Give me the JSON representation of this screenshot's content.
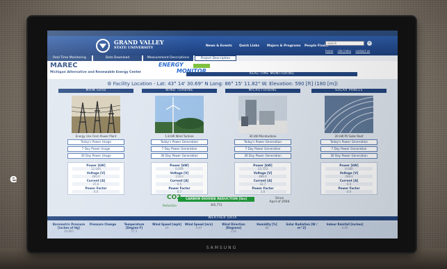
{
  "monitor": {
    "brand": "SAMSUNG"
  },
  "header": {
    "logo_name": "GRAND VALLEY",
    "logo_sub": "STATE UNIVERSITY",
    "nav": [
      "News & Events",
      "Quick Links",
      "Majors & Programs",
      "People Finder"
    ],
    "search_placeholder": "search",
    "search_go": "»",
    "sublinks": [
      "home",
      "site index",
      "contact us"
    ]
  },
  "tabs": [
    "Real Time Monitoring",
    "Data Download",
    "Measurement Descriptions",
    "Project Description"
  ],
  "brand": {
    "title": "MAREC",
    "subtitle": "Michigan Alternative and Renewable Energy Center",
    "energy": "ENERGY",
    "monitor": "MONITOR"
  },
  "rtm_label": "REAL-TIME MONITORING",
  "facility_line": "Facility Location - Lat: 43° 14' 30.69\" N   Long: 86° 15' 11.82\" W.   Elevation: 590 [ft] (180 [m])",
  "columns": [
    {
      "head": "MAIN GRID",
      "caption": "Energy Use From Power Plant",
      "buttons": [
        "Today's Power Usage",
        "7 Day Power Usage",
        "30 Day Power Usage"
      ],
      "readings": [
        {
          "label": "Power [kW]",
          "value": "12.040"
        },
        {
          "label": "Voltage [V]",
          "value": "490.0"
        },
        {
          "label": "Current [A]",
          "value": "25.6"
        },
        {
          "label": "Power Factor",
          "value": "0.0"
        }
      ]
    },
    {
      "head": "WIND TURBINE",
      "caption": "1.8 kW Wind Turbine",
      "buttons": [
        "Today's Power Generation",
        "7 Day Power Generation",
        "30 Day Power Generation"
      ],
      "readings": [
        {
          "label": "Power [kW]",
          "value": "0.059"
        },
        {
          "label": "Voltage [V]",
          "value": "119.0"
        },
        {
          "label": "Current [A]",
          "value": "0.5"
        },
        {
          "label": "Power Factor",
          "value": "0.7"
        }
      ]
    },
    {
      "head": "MICROTURBINE",
      "caption": "30 kW Microturbine",
      "buttons": [
        "Today's Power Generation",
        "7 Day Power Generation",
        "30 Day Power Generation"
      ],
      "readings": [
        {
          "label": "Power [kW]",
          "value": "23.723"
        },
        {
          "label": "Voltage [V]",
          "value": "489.0"
        },
        {
          "label": "Current [A]",
          "value": "32.7"
        },
        {
          "label": "Power Factor",
          "value": "1.0"
        }
      ]
    },
    {
      "head": "SOLAR PANELS",
      "caption": "20 kW PV Solar Roof",
      "buttons": [
        "Today's Power Generation",
        "7 Day Power Generation",
        "30 Day Power Generation"
      ],
      "readings": [
        {
          "label": "Power [kW]",
          "value": "0.000"
        },
        {
          "label": "Voltage [V]",
          "value": "208.0"
        },
        {
          "label": "Current [A]",
          "value": "0.0"
        },
        {
          "label": "Power Factor",
          "value": "0.0"
        }
      ]
    }
  ],
  "carbon": {
    "icon_text": "CO2",
    "icon_sub": "Reduction",
    "label": "CARBON DIOXIDE REDUCTION [lbs]",
    "value": "305,773",
    "since_label": "Since",
    "since_date": "April of 2004"
  },
  "weather": {
    "label": "WEATHER DATA",
    "items": [
      {
        "label": "Barometric Pressure [inches of Hg]",
        "value": "29.895"
      },
      {
        "label": "Pressure Change",
        "value": ""
      },
      {
        "label": "Temperature [Degree F]",
        "value": "57.5"
      },
      {
        "label": "Wind Speed [mph]",
        "value": "10"
      },
      {
        "label": "Wind Speed [m/s]",
        "value": "4.47"
      },
      {
        "label": "Wind Direction [Degrees]",
        "value": "216"
      },
      {
        "label": "Humidity [%]",
        "value": "60"
      },
      {
        "label": "Solar Radiation [W / m^2]",
        "value": ""
      },
      {
        "label": "Indoor Rainfall [inches]",
        "value": "0.00"
      }
    ]
  }
}
